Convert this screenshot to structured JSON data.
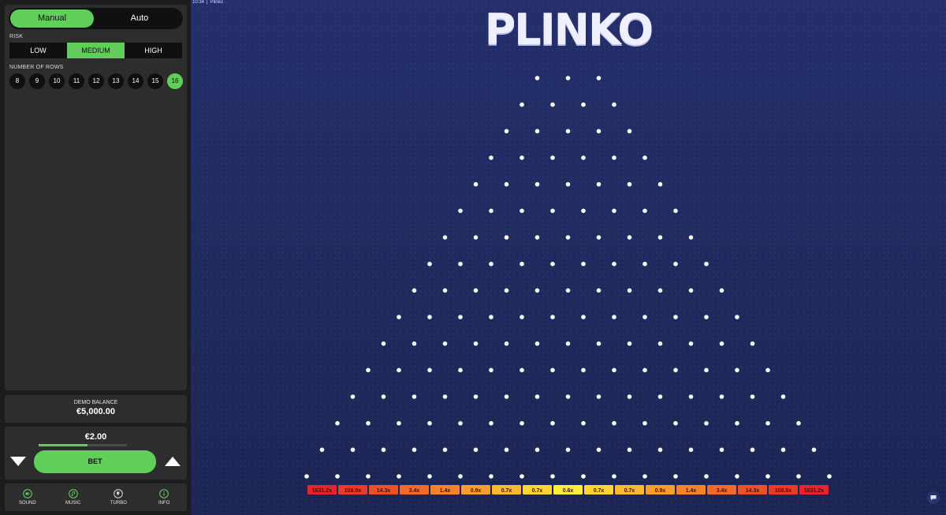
{
  "sidebar": {
    "modes": [
      {
        "label": "Manual",
        "active": true
      },
      {
        "label": "Auto",
        "active": false
      }
    ],
    "risk_label": "RISK",
    "risk_options": [
      {
        "label": "LOW",
        "active": false
      },
      {
        "label": "MEDIUM",
        "active": true
      },
      {
        "label": "HIGH",
        "active": false
      }
    ],
    "rows_label": "NUMBER OF ROWS",
    "row_options": [
      "8",
      "9",
      "10",
      "11",
      "12",
      "13",
      "14",
      "15",
      "16"
    ],
    "selected_rows": "16",
    "balance": {
      "title": "DEMO BALANCE",
      "value": "€5,000.00"
    },
    "bet": {
      "amount": "€2.00",
      "button_label": "BET",
      "slider_fraction": 0.55
    },
    "footer": [
      {
        "label": "SOUND",
        "icon": "sound-icon"
      },
      {
        "label": "MUSIC",
        "icon": "music-icon"
      },
      {
        "label": "TURBO",
        "icon": "turbo-icon"
      },
      {
        "label": "INFO",
        "icon": "info-icon"
      }
    ]
  },
  "game": {
    "time": "10:34",
    "game_name": "Plinko",
    "title": "PLINKO",
    "peg_rows": 16,
    "multipliers": [
      "1631.2x",
      "108.9x",
      "14.3x",
      "3.4x",
      "1.4x",
      "0.9x",
      "0.7x",
      "0.7x",
      "0.6x",
      "0.7x",
      "0.7x",
      "0.9x",
      "1.4x",
      "3.4x",
      "14.3x",
      "108.9x",
      "1631.2x"
    ],
    "multiplier_colors": [
      "#e6242b",
      "#ea3a2a",
      "#ee5128",
      "#f26a2a",
      "#f6832b",
      "#f99e2d",
      "#fbb92f",
      "#fdd532",
      "#ffee38",
      "#fdd532",
      "#fbb92f",
      "#f99e2d",
      "#f6832b",
      "#f26a2a",
      "#ee5128",
      "#ea3a2a",
      "#e6242b"
    ],
    "colors": {
      "accent": "#5fcf5a",
      "background": "#232e66",
      "peg": "#ffffff"
    }
  }
}
